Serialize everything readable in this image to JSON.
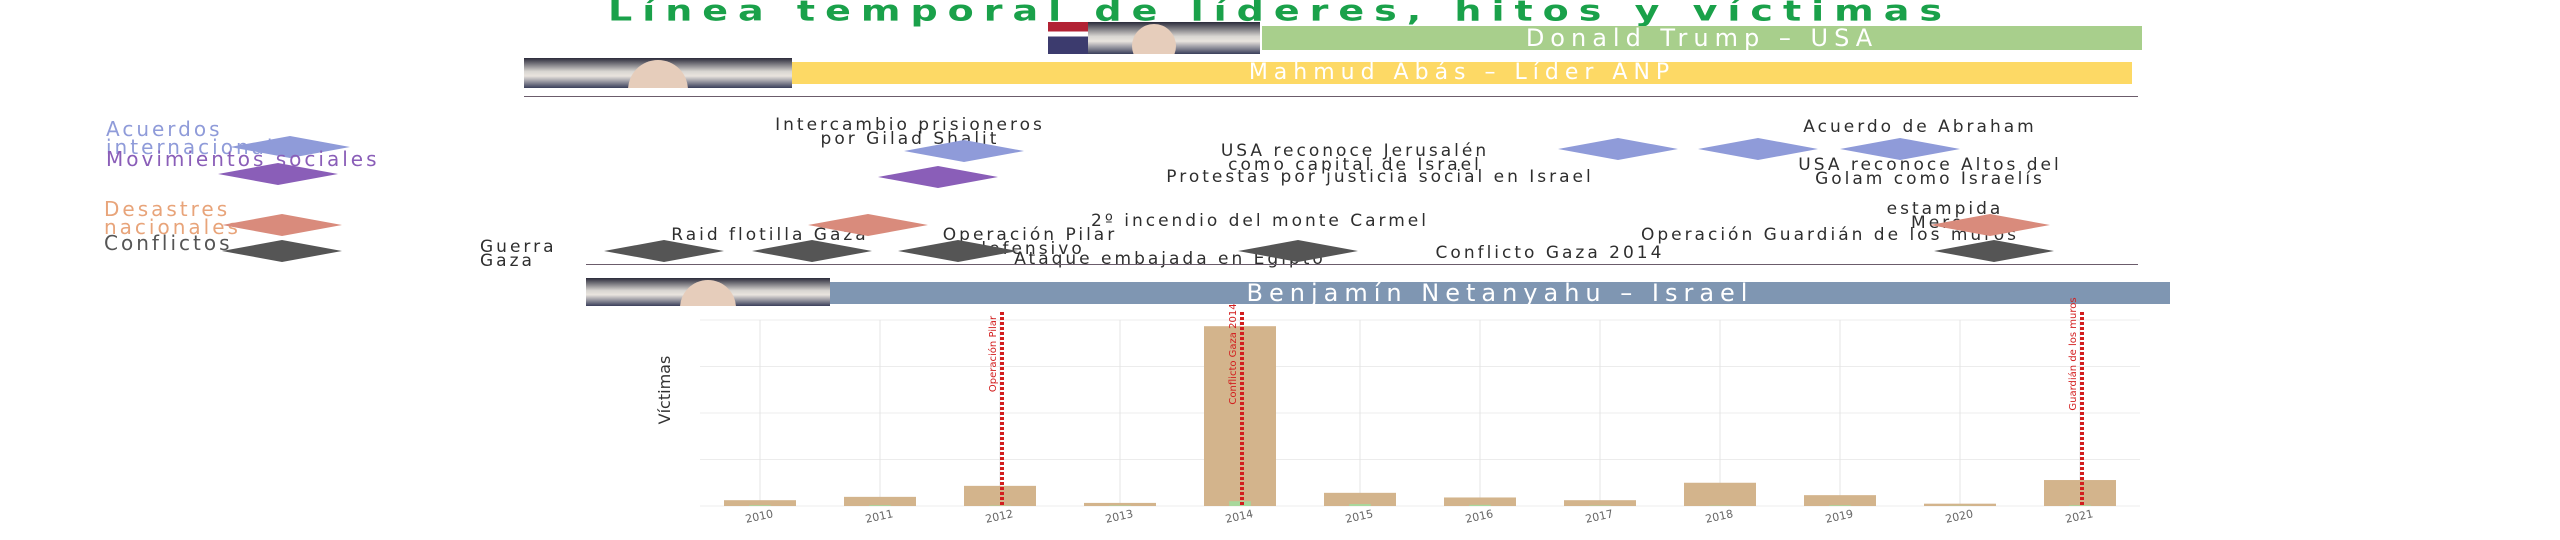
{
  "title": "Línea temporal de líderes, hitos y víctimas",
  "leaders": [
    {
      "label": "Donald Trump – USA",
      "color": "#a8cf8c"
    },
    {
      "label": "Mahmud Abás – Líder ANP",
      "color": "#fdd965"
    },
    {
      "label": "Benjamín Netanyahu – Israel",
      "color": "#7f96b2"
    }
  ],
  "legend": [
    {
      "label": "Acuerdos internacionales",
      "color": "#8f9bd9"
    },
    {
      "label": "Movimientos sociales",
      "color": "#8a5eb8"
    },
    {
      "label": "Desastres nacionales",
      "color": "#d98b7c"
    },
    {
      "label": "Conflictos",
      "color": "#555555"
    }
  ],
  "events": [
    {
      "label": "Intercambio prisioneros por Gilad Shalit",
      "category": 0
    },
    {
      "label": "USA reconoce Jerusalén como capital de Israel",
      "category": 0
    },
    {
      "label": "Acuerdo de Abraham",
      "category": 0
    },
    {
      "label": "USA reconoce Altos del Golam como Israelís",
      "category": 0
    },
    {
      "label": "Protestas por justicia social en Israel",
      "category": 1
    },
    {
      "label": "2º incendio del monte Carmel",
      "category": 2
    },
    {
      "label": "estampida Meron",
      "category": 2
    },
    {
      "label": "Raid flotilla Gaza",
      "category": 3
    },
    {
      "label": "Operación Pilar defensivo",
      "category": 3
    },
    {
      "label": "Operación Guardián de los muros",
      "category": 3
    },
    {
      "label": "Guerra Gaza",
      "category": 3
    },
    {
      "label": "Ataque embajada en Egipto",
      "category": 3
    },
    {
      "label": "Conflicto Gaza 2014",
      "category": 3
    }
  ],
  "chart_data": {
    "type": "bar",
    "ylabel": "Víctimas",
    "categories": [
      "2010",
      "2011",
      "2012",
      "2013",
      "2014",
      "2015",
      "2016",
      "2017",
      "2018",
      "2019",
      "2020",
      "2021"
    ],
    "series": [
      {
        "values": [
          75,
          118,
          260,
          40,
          2320,
          170,
          110,
          75,
          300,
          140,
          30,
          335
        ],
        "color": "#d3b48c"
      },
      {
        "values": [
          10,
          11,
          5,
          6,
          62,
          25,
          15,
          5,
          4,
          10,
          3,
          10
        ],
        "color": "#a8d89c"
      }
    ],
    "ylim": [
      0,
      2400
    ],
    "vlines": [
      {
        "at": "2012",
        "label": "Operación Pilar",
        "color": "#d21e1e"
      },
      {
        "at": "2014",
        "label": "Conflicto Gaza 2014",
        "color": "#d21e1e"
      },
      {
        "at": "2021",
        "label": "Guardián de los muros",
        "color": "#d21e1e"
      }
    ],
    "grid": true
  }
}
